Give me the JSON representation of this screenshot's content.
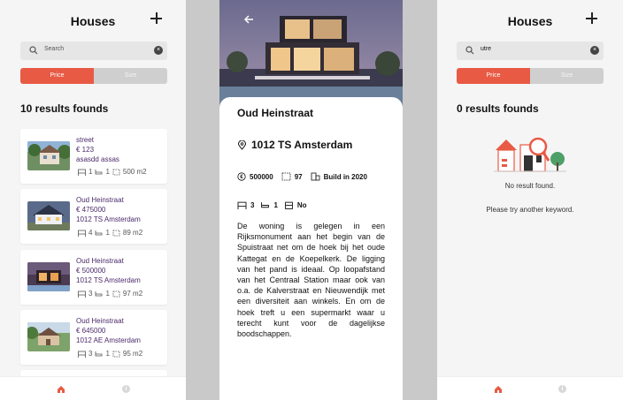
{
  "list": {
    "title": "Houses",
    "search_placeholder": "Search",
    "segments": [
      "Price",
      "Size"
    ],
    "results_text": "10 results founds",
    "cards": [
      {
        "name": "street",
        "price": "€ 123",
        "address": "asasdd assas",
        "beds": "1",
        "baths": "1",
        "size": "500 m2"
      },
      {
        "name": "Oud Heinstraat",
        "price": "€ 475000",
        "address": "1012 TS Amsterdam",
        "beds": "4",
        "baths": "1",
        "size": "89 m2"
      },
      {
        "name": "Oud Heinstraat",
        "price": "€ 500000",
        "address": "1012 TS Amsterdam",
        "beds": "3",
        "baths": "1",
        "size": "97 m2"
      },
      {
        "name": "Oud Heinstraat",
        "price": "€ 645000",
        "address": "1012 AE Amsterdam",
        "beds": "3",
        "baths": "1",
        "size": "95 m2"
      }
    ]
  },
  "detail": {
    "title": "Oud Heinstraat",
    "address": "1012 TS  Amsterdam",
    "price": "500000",
    "size": "97",
    "build": "Build in 2020",
    "beds": "3",
    "baths": "1",
    "garage": "No",
    "description": "De woning is gelegen in een Rijksmonument aan het begin van de Spuistraat net om de hoek bij het oude Kattegat en de Koepelkerk. De ligging van het pand is ideaal. Op loopafstand van het Centraal Station maar ook van o.a. de Kalverstraat en Nieuwendijk met een diversiteit aan winkels. En om de hoek treft u een supermarkt waar u terecht kunt voor de dagelijkse boodschappen."
  },
  "empty": {
    "title": "Houses",
    "search_value": "utre",
    "segments": [
      "Price",
      "Size"
    ],
    "results_text": "0 results founds",
    "message": "No result found.",
    "hint": "Please try another keyword."
  },
  "colors": {
    "accent": "#e85a44",
    "card_text": "#4b2a6a"
  }
}
